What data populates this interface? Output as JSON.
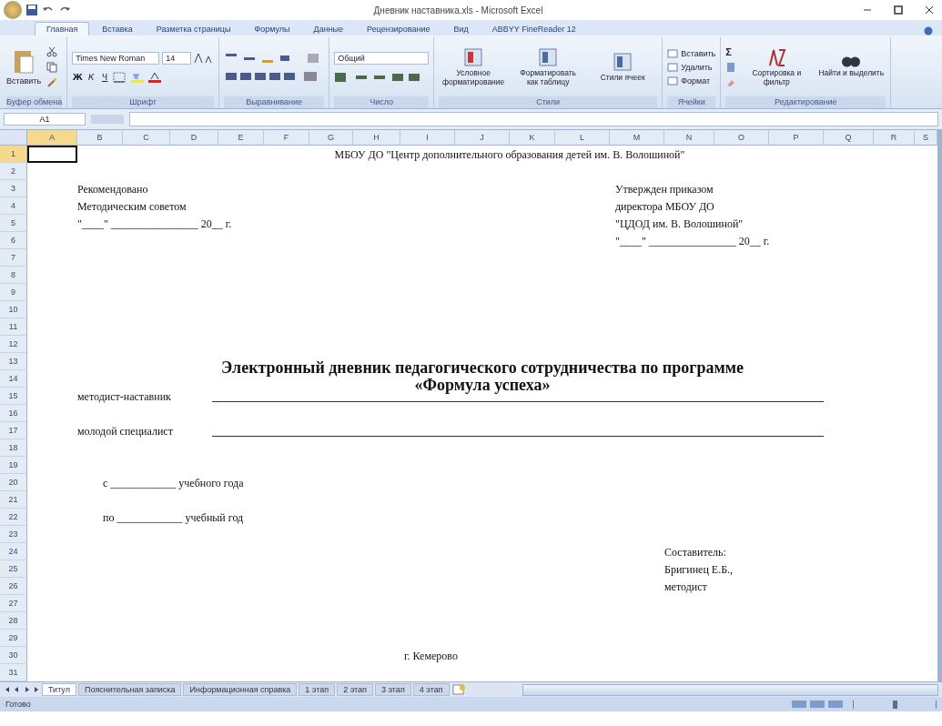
{
  "window": {
    "title": "Дневник наставника.xls - Microsoft Excel"
  },
  "ribbon_tabs": [
    {
      "label": "Главная",
      "selected": true
    },
    {
      "label": "Вставка",
      "selected": false
    },
    {
      "label": "Разметка страницы",
      "selected": false
    },
    {
      "label": "Формулы",
      "selected": false
    },
    {
      "label": "Данные",
      "selected": false
    },
    {
      "label": "Рецензирование",
      "selected": false
    },
    {
      "label": "Вид",
      "selected": false
    },
    {
      "label": "ABBYY FineReader 12",
      "selected": false
    }
  ],
  "ribbon_groups": [
    {
      "kind": "clipboard",
      "name": "Буфер обмена",
      "labels": [
        "Вставить"
      ]
    },
    {
      "kind": "font",
      "name": "Шрифт",
      "labels": [
        "Times New Roman",
        "14",
        "Ж",
        "К",
        "Ч"
      ]
    },
    {
      "kind": "alignment",
      "name": "Выравнивание"
    },
    {
      "kind": "number",
      "name": "Число",
      "labels": [
        "Общий"
      ]
    },
    {
      "kind": "styles",
      "name": "Стили",
      "labels": [
        "Условное форматирование",
        "Форматировать как таблицу",
        "Стили ячеек"
      ]
    },
    {
      "kind": "cells",
      "name": "Ячейки",
      "labels": [
        "Вставить",
        "Удалить",
        "Формат"
      ]
    },
    {
      "kind": "editing",
      "name": "Редактирование",
      "labels": [
        "Σ",
        "Сортировка и фильтр",
        "Найти и выделить"
      ]
    }
  ],
  "formula_bar": {
    "name_box": "A1"
  },
  "columns": [
    {
      "letter": "A",
      "selected": true
    },
    {
      "letter": "B",
      "selected": false
    },
    {
      "letter": "C",
      "selected": false
    },
    {
      "letter": "D",
      "selected": false
    },
    {
      "letter": "E",
      "selected": false
    },
    {
      "letter": "F",
      "selected": false
    },
    {
      "letter": "G",
      "selected": false
    },
    {
      "letter": "H",
      "selected": false
    },
    {
      "letter": "I",
      "selected": false
    },
    {
      "letter": "J",
      "selected": false
    },
    {
      "letter": "K",
      "selected": false
    },
    {
      "letter": "L",
      "selected": false
    },
    {
      "letter": "M",
      "selected": false
    },
    {
      "letter": "N",
      "selected": false
    },
    {
      "letter": "O",
      "selected": false
    },
    {
      "letter": "P",
      "selected": false
    },
    {
      "letter": "Q",
      "selected": false
    },
    {
      "letter": "R",
      "selected": false
    },
    {
      "letter": "S",
      "selected": false
    }
  ],
  "rows": [
    {
      "number": "1",
      "selected": true,
      "cells": [
        {
          "kind": "center",
          "text": "МБОУ ДО \"Центр дополнительного образования детей им. В. Волошиной\""
        }
      ]
    },
    {
      "number": "2",
      "selected": false,
      "cells": []
    },
    {
      "number": "3",
      "selected": false,
      "cells": [
        {
          "kind": "left",
          "text": "Рекомендовано"
        },
        {
          "kind": "right",
          "text": "Утвержден приказом"
        }
      ]
    },
    {
      "number": "4",
      "selected": false,
      "cells": [
        {
          "kind": "left",
          "text": "Методическим советом"
        },
        {
          "kind": "right",
          "text": "директора МБОУ ДО"
        }
      ]
    },
    {
      "number": "5",
      "selected": false,
      "cells": [
        {
          "kind": "left",
          "text": "\"____\" ________________ 20__ г."
        },
        {
          "kind": "right",
          "text": "\"ЦДОД им. В. Волошиной\""
        }
      ]
    },
    {
      "number": "6",
      "selected": false,
      "cells": [
        {
          "kind": "right",
          "text": "\"____\" ________________ 20__ г."
        }
      ]
    },
    {
      "number": "7",
      "selected": false,
      "cells": []
    },
    {
      "number": "8",
      "selected": false,
      "cells": []
    },
    {
      "number": "9",
      "selected": false,
      "cells": []
    },
    {
      "number": "10",
      "selected": false,
      "cells": []
    },
    {
      "number": "11",
      "selected": false,
      "cells": []
    },
    {
      "number": "12",
      "selected": false,
      "cells": []
    },
    {
      "number": "13",
      "selected": false,
      "cells": [
        {
          "kind": "heading",
          "text": "Электронный дневник педагогического сотрудничества по программе"
        }
      ]
    },
    {
      "number": "14",
      "selected": false,
      "cells": [
        {
          "kind": "heading",
          "text": "«Формула успеха»"
        }
      ]
    },
    {
      "number": "15",
      "selected": false,
      "cells": [
        {
          "kind": "field",
          "text": "методист-наставник"
        }
      ]
    },
    {
      "number": "16",
      "selected": false,
      "cells": []
    },
    {
      "number": "17",
      "selected": false,
      "cells": [
        {
          "kind": "field",
          "text": "молодой специалист"
        }
      ]
    },
    {
      "number": "18",
      "selected": false,
      "cells": []
    },
    {
      "number": "19",
      "selected": false,
      "cells": []
    },
    {
      "number": "20",
      "selected": false,
      "cells": [
        {
          "kind": "indent",
          "text": "с ____________ учебного года"
        }
      ]
    },
    {
      "number": "21",
      "selected": false,
      "cells": []
    },
    {
      "number": "22",
      "selected": false,
      "cells": [
        {
          "kind": "indent",
          "text": "по ____________ учебный год"
        }
      ]
    },
    {
      "number": "23",
      "selected": false,
      "cells": []
    },
    {
      "number": "24",
      "selected": false,
      "cells": [
        {
          "kind": "signer",
          "text": "Составитель:"
        }
      ]
    },
    {
      "number": "25",
      "selected": false,
      "cells": [
        {
          "kind": "signer",
          "text": "Бригинец Е.Б.,"
        }
      ]
    },
    {
      "number": "26",
      "selected": false,
      "cells": [
        {
          "kind": "signer",
          "text": "методист"
        }
      ]
    },
    {
      "number": "27",
      "selected": false,
      "cells": []
    },
    {
      "number": "28",
      "selected": false,
      "cells": []
    },
    {
      "number": "29",
      "selected": false,
      "cells": []
    },
    {
      "number": "30",
      "selected": false,
      "cells": [
        {
          "kind": "footer",
          "text": "г. Кемерово"
        }
      ]
    },
    {
      "number": "31",
      "selected": false,
      "cells": []
    }
  ],
  "sheet_tabs": [
    {
      "label": "Титул",
      "selected": true
    },
    {
      "label": "Пояснительная записка",
      "selected": false
    },
    {
      "label": "Информационная справка",
      "selected": false
    },
    {
      "label": "1 этап",
      "selected": false
    },
    {
      "label": "2 этап",
      "selected": false
    },
    {
      "label": "3 этап",
      "selected": false
    },
    {
      "label": "4 этап",
      "selected": false
    }
  ],
  "status_bar": {
    "text": "Готово",
    "zoom": {
      "level": 0.5
    }
  }
}
